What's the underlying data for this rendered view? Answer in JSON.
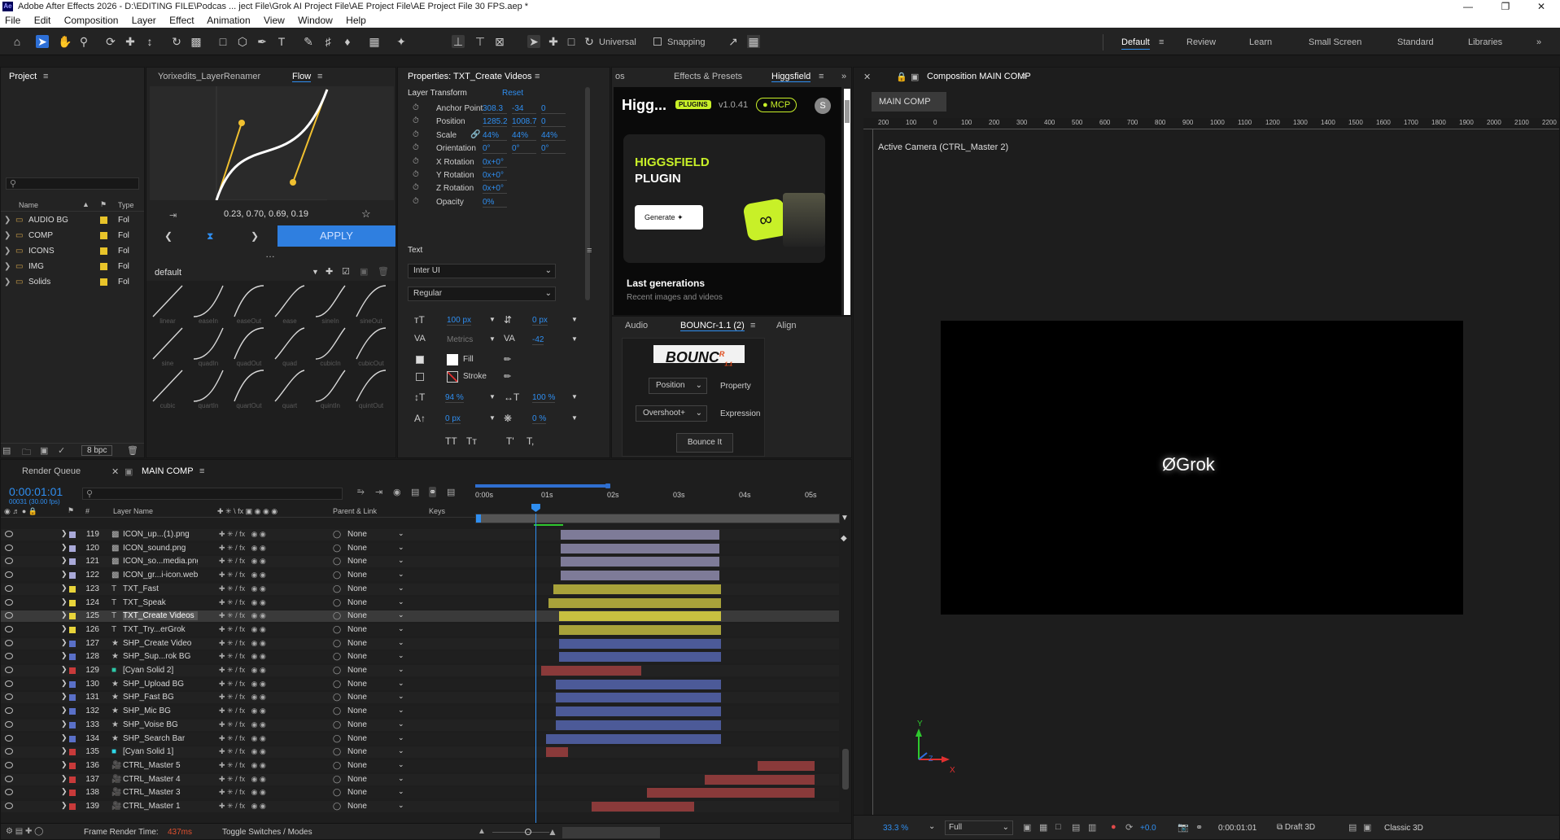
{
  "window": {
    "title": "Adobe After Effects 2026 - D:\\EDITING FILE\\Podcas ... ject File\\Grok AI Project File\\AE Project File\\AE Project File 30 FPS.aep *",
    "app_icon": "Ae"
  },
  "menu": [
    "File",
    "Edit",
    "Composition",
    "Layer",
    "Effect",
    "Animation",
    "View",
    "Window",
    "Help"
  ],
  "toolbar": {
    "universal_label": "Universal",
    "snapping_label": "Snapping",
    "workspaces": [
      "Default",
      "Review",
      "Learn",
      "Small Screen",
      "Standard",
      "Libraries"
    ],
    "active_workspace": "Default"
  },
  "project": {
    "tab": "Project",
    "search_placeholder": "",
    "columns": [
      "Name",
      "Type"
    ],
    "items": [
      {
        "name": "AUDIO BG",
        "type": "Fol"
      },
      {
        "name": "COMP",
        "type": "Fol"
      },
      {
        "name": "ICONS",
        "type": "Fol"
      },
      {
        "name": "IMG",
        "type": "Fol"
      },
      {
        "name": "Solids",
        "type": "Fol"
      }
    ],
    "bpc": "8 bpc",
    "folder_color": "#e8c42a"
  },
  "flow": {
    "tabs": [
      "Yorixedits_LayerRenamer",
      "Flow"
    ],
    "active_tab": "Flow",
    "bezier_value": "0.23, 0.70, 0.69, 0.19",
    "apply_label": "APPLY",
    "preset_label": "default",
    "easings": [
      "linear",
      "easeIn",
      "easeOut",
      "ease",
      "sineIn",
      "sineOut",
      "sine",
      "quadIn",
      "quadOut",
      "quad",
      "cubicIn",
      "cubicOut",
      "cubic",
      "quartIn",
      "quartOut",
      "quart",
      "quintIn",
      "quintOut"
    ],
    "accent": "#2f7fe0"
  },
  "properties": {
    "tab": "Properties: TXT_Create Videos",
    "section_transform": "Layer Transform",
    "reset_label": "Reset",
    "rows": [
      {
        "label": "Anchor Point",
        "values": [
          "308.3",
          "-34",
          "0"
        ]
      },
      {
        "label": "Position",
        "values": [
          "1285.2",
          "1008.7",
          "0"
        ]
      },
      {
        "label": "Scale",
        "values": [
          "44%",
          "44%",
          "44%"
        ]
      },
      {
        "label": "Orientation",
        "values": [
          "0°",
          "0°",
          "0°"
        ]
      },
      {
        "label": "X Rotation",
        "values": [
          "0x+0°"
        ]
      },
      {
        "label": "Y Rotation",
        "values": [
          "0x+0°"
        ]
      },
      {
        "label": "Z Rotation",
        "values": [
          "0x+0°"
        ]
      },
      {
        "label": "Opacity",
        "values": [
          "0%"
        ]
      }
    ],
    "section_text": "Text",
    "font": "Inter UI",
    "style": "Regular",
    "font_size": "100 px",
    "leading": "0 px",
    "kerning": "Metrics",
    "tracking": "-42",
    "fill_label": "Fill",
    "stroke_label": "Stroke",
    "vert_scale": "94 %",
    "horiz_scale": "100 %",
    "baseline": "0 px",
    "tsume": "0 %",
    "caps": [
      "TT",
      "Tт",
      "T'",
      "T,"
    ]
  },
  "higgsfield": {
    "tabs": [
      "os",
      "Effects & Presets",
      "Higgsfield"
    ],
    "active_tab": "Higgsfield",
    "title": "Higg...",
    "badge": "PLUGINS",
    "version": "v1.0.41",
    "mcp": "MCP",
    "avatar": "S",
    "card_title_1": "HIGGSFIELD",
    "card_title_2": "PLUGIN",
    "generate_label": "Generate",
    "last_gen": "Last generations",
    "last_gen_sub": "Recent images and videos",
    "accent": "#c8f028"
  },
  "bounce": {
    "tabs": [
      "Audio",
      "BOUNCr-1.1 (2)",
      "Align"
    ],
    "active_tab": "BOUNCr-1.1 (2)",
    "logo": "BOUNC",
    "logo_sup": "R",
    "logo_ver": "1.1",
    "property_select": "Position",
    "property_label": "Property",
    "expression_select": "Overshoot+",
    "expression_label": "Expression",
    "button": "Bounce It"
  },
  "composition": {
    "tab": "Composition MAIN COMP",
    "comp_button": "MAIN COMP",
    "ruler": [
      "200",
      "100",
      "0",
      "100",
      "200",
      "300",
      "400",
      "500",
      "600",
      "700",
      "800",
      "900",
      "1000",
      "1100",
      "1200",
      "1300",
      "1400",
      "1500",
      "1600",
      "1700",
      "1800",
      "1900",
      "2000",
      "2100",
      "2200"
    ],
    "camera": "Active Camera (CTRL_Master 2)",
    "logo_text": "Grok",
    "axis_y": "Y",
    "axis_x": "X",
    "axis_z": "Z",
    "zoom": "33.3 %",
    "resolution": "Full",
    "exposure": "+0.0",
    "timecode": "0:00:01:01",
    "renderer": "Draft 3D",
    "mode": "Classic 3D"
  },
  "timeline": {
    "tabs": [
      "Render Queue",
      "MAIN COMP"
    ],
    "active_tab": "MAIN COMP",
    "timecode": "0:00:01:01",
    "frame_info": "00031 (30.00 fps)",
    "columns": [
      "#",
      "Layer Name",
      "Parent & Link",
      "Keys"
    ],
    "time_marks": [
      "0:00s",
      "01s",
      "02s",
      "03s",
      "04s",
      "05s"
    ],
    "footer_render": "Frame Render Time:",
    "footer_ms": "437ms",
    "footer_toggle": "Toggle Switches / Modes",
    "parent_value": "None",
    "layers": [
      {
        "num": "119",
        "name": "ICON_up...(1).png",
        "icon": "img",
        "label": "#a9a9d8",
        "bar": "#7e7b98",
        "start": 0.235,
        "end": 0.67
      },
      {
        "num": "120",
        "name": "ICON_sound.png",
        "icon": "img",
        "label": "#a9a9d8",
        "bar": "#7e7b98",
        "start": 0.235,
        "end": 0.67
      },
      {
        "num": "121",
        "name": "ICON_so...media.png",
        "icon": "img",
        "label": "#a9a9d8",
        "bar": "#7e7b98",
        "start": 0.235,
        "end": 0.67
      },
      {
        "num": "122",
        "name": "ICON_gr...i-icon.webp",
        "icon": "img",
        "label": "#a9a9d8",
        "bar": "#7e7b98",
        "start": 0.235,
        "end": 0.67
      },
      {
        "num": "123",
        "name": "TXT_Fast",
        "icon": "T",
        "label": "#e8d43a",
        "bar": "#a8a23a",
        "start": 0.215,
        "end": 0.675
      },
      {
        "num": "124",
        "name": "TXT_Speak",
        "icon": "T",
        "label": "#e8d43a",
        "bar": "#a8a23a",
        "start": 0.2,
        "end": 0.675
      },
      {
        "num": "125",
        "name": "TXT_Create Videos",
        "icon": "T",
        "label": "#e8d43a",
        "bar": "#c8c040",
        "start": 0.23,
        "end": 0.675,
        "selected": true
      },
      {
        "num": "126",
        "name": "TXT_Try...erGrok",
        "icon": "T",
        "label": "#e8d43a",
        "bar": "#a8a23a",
        "start": 0.23,
        "end": 0.675
      },
      {
        "num": "127",
        "name": "SHP_Create Video",
        "icon": "star",
        "label": "#5a70c8",
        "bar": "#4c5a98",
        "start": 0.23,
        "end": 0.675
      },
      {
        "num": "128",
        "name": "SHP_Sup...rok BG",
        "icon": "star",
        "label": "#5a70c8",
        "bar": "#4c5a98",
        "start": 0.23,
        "end": 0.675
      },
      {
        "num": "129",
        "name": "[Cyan Solid 2]",
        "icon": "solid",
        "label": "#c83a3a",
        "bar": "#8a3a3a",
        "start": 0.18,
        "end": 0.455
      },
      {
        "num": "130",
        "name": "SHP_Upload BG",
        "icon": "star",
        "label": "#5a70c8",
        "bar": "#4c5a98",
        "start": 0.22,
        "end": 0.675
      },
      {
        "num": "131",
        "name": "SHP_Fast BG",
        "icon": "star",
        "label": "#5a70c8",
        "bar": "#4c5a98",
        "start": 0.22,
        "end": 0.675
      },
      {
        "num": "132",
        "name": "SHP_Mic BG",
        "icon": "star",
        "label": "#5a70c8",
        "bar": "#4c5a98",
        "start": 0.22,
        "end": 0.675
      },
      {
        "num": "133",
        "name": "SHP_Voise BG",
        "icon": "star",
        "label": "#5a70c8",
        "bar": "#4c5a98",
        "start": 0.22,
        "end": 0.675
      },
      {
        "num": "134",
        "name": "SHP_Search Bar",
        "icon": "star",
        "label": "#5a70c8",
        "bar": "#4c5a98",
        "start": 0.195,
        "end": 0.675
      },
      {
        "num": "135",
        "name": "[Cyan Solid 1]",
        "icon": "solid",
        "label": "#c83a3a",
        "bar": "#8a3a3a",
        "start": 0.195,
        "end": 0.255
      },
      {
        "num": "136",
        "name": "CTRL_Master 5",
        "icon": "cam",
        "label": "#c83a3a",
        "bar": "#8a3a3a",
        "start": 0.775,
        "end": 0.93
      },
      {
        "num": "137",
        "name": "CTRL_Master 4",
        "icon": "cam",
        "label": "#c83a3a",
        "bar": "#8a3a3a",
        "start": 0.63,
        "end": 0.93
      },
      {
        "num": "138",
        "name": "CTRL_Master 3",
        "icon": "cam",
        "label": "#c83a3a",
        "bar": "#8a3a3a",
        "start": 0.47,
        "end": 0.93
      },
      {
        "num": "139",
        "name": "CTRL_Master 1",
        "icon": "cam",
        "label": "#c83a3a",
        "bar": "#8a3a3a",
        "start": 0.32,
        "end": 0.6
      }
    ]
  }
}
